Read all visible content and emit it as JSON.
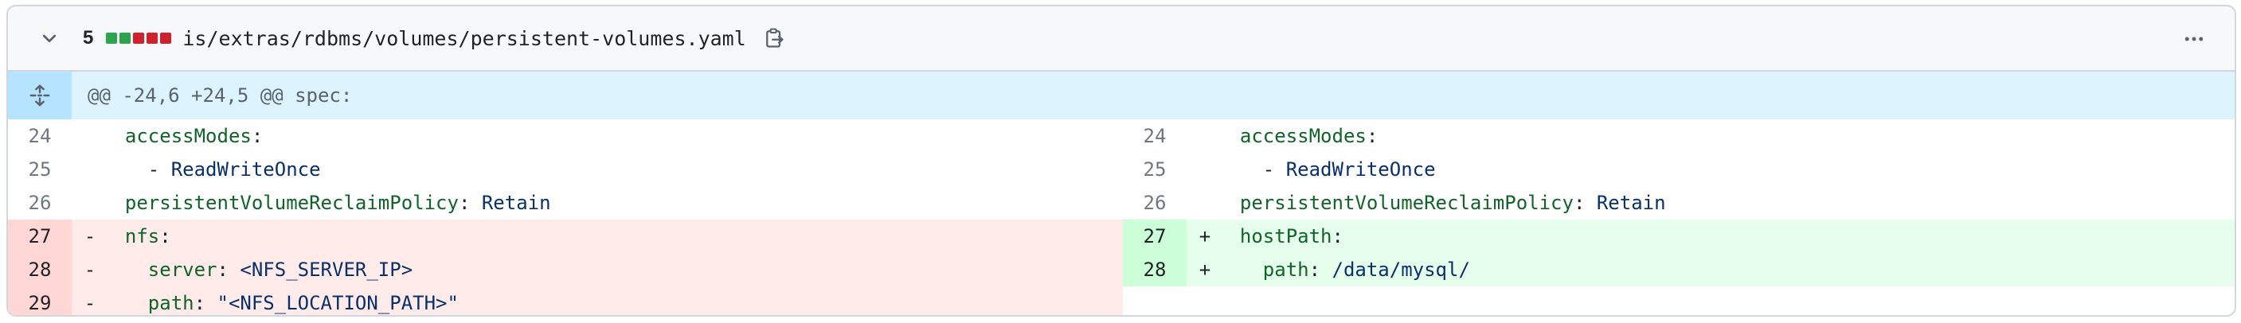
{
  "file": {
    "diff_count": "5",
    "path": "is/extras/rdbms/volumes/persistent-volumes.yaml",
    "diffstat_colors": [
      "#2da44e",
      "#2da44e",
      "#cf222e",
      "#cf222e",
      "#cf222e"
    ],
    "icons": {
      "collapse": "chevron-down-icon",
      "copy": "copy-icon",
      "more": "kebab-horizontal-icon",
      "expand": "unfold-icon"
    }
  },
  "hunk": {
    "header": "@@ -24,6 +24,5 @@ spec:"
  },
  "left": [
    {
      "num": "24",
      "marker": "",
      "indent": "  ",
      "key": "accessModes",
      "sep": ":",
      "value": ""
    },
    {
      "num": "25",
      "marker": "",
      "indent": "    ",
      "key": "",
      "sep": "- ",
      "value": "ReadWriteOnce"
    },
    {
      "num": "26",
      "marker": "",
      "indent": "  ",
      "key": "persistentVolumeReclaimPolicy",
      "sep": ": ",
      "value": "Retain"
    },
    {
      "num": "27",
      "marker": "-",
      "indent": "  ",
      "key": "nfs",
      "sep": ":",
      "value": ""
    },
    {
      "num": "28",
      "marker": "-",
      "indent": "    ",
      "key": "server",
      "sep": ": ",
      "value": "<NFS_SERVER_IP>"
    },
    {
      "num": "29",
      "marker": "-",
      "indent": "    ",
      "key": "path",
      "sep": ": ",
      "value": "\"<NFS_LOCATION_PATH>\""
    }
  ],
  "right": [
    {
      "num": "24",
      "marker": "",
      "indent": "  ",
      "key": "accessModes",
      "sep": ":",
      "value": ""
    },
    {
      "num": "25",
      "marker": "",
      "indent": "    ",
      "key": "",
      "sep": "- ",
      "value": "ReadWriteOnce"
    },
    {
      "num": "26",
      "marker": "",
      "indent": "  ",
      "key": "persistentVolumeReclaimPolicy",
      "sep": ": ",
      "value": "Retain"
    },
    {
      "num": "27",
      "marker": "+",
      "indent": "  ",
      "key": "hostPath",
      "sep": ":",
      "value": ""
    },
    {
      "num": "28",
      "marker": "+",
      "indent": "    ",
      "key": "path",
      "sep": ": ",
      "value": "/data/mysql/"
    }
  ]
}
